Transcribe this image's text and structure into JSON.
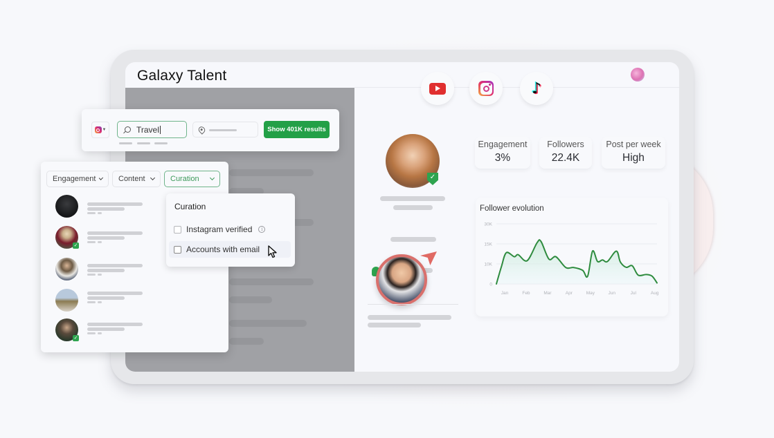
{
  "app": {
    "title": "Galaxy Talent"
  },
  "social_platforms": [
    {
      "name": "YouTube",
      "icon": "youtube-icon"
    },
    {
      "name": "Instagram",
      "icon": "instagram-icon"
    },
    {
      "name": "TikTok",
      "icon": "tiktok-icon",
      "glyph": "♪"
    }
  ],
  "search": {
    "platform": "Instagram",
    "query": "Travel",
    "location_placeholder": "",
    "results_button": "Show 401K results"
  },
  "filters": {
    "buttons": [
      {
        "label": "Engagement",
        "active": false
      },
      {
        "label": "Content",
        "active": false
      },
      {
        "label": "Curation",
        "active": true
      }
    ]
  },
  "creator_list": [
    {
      "verified": false
    },
    {
      "verified": true
    },
    {
      "verified": false
    },
    {
      "verified": false
    },
    {
      "verified": true
    }
  ],
  "curation_dropdown": {
    "title": "Curation",
    "options": [
      {
        "label": "Instagram verified",
        "checked": false,
        "info_icon": true
      },
      {
        "label": "Accounts with email",
        "checked": false,
        "hovered": true
      }
    ]
  },
  "profile": {
    "verified": true,
    "check_glyph": "✓",
    "stats": [
      {
        "label": "Engagement",
        "value": "3%"
      },
      {
        "label": "Followers",
        "value": "22.4K"
      },
      {
        "label": "Post per week",
        "value": "High"
      }
    ]
  },
  "colors": {
    "accent_green": "#23a047",
    "chart_line": "#2e8b3e",
    "verified_green": "#2ea44f",
    "youtube_red": "#e02f2f",
    "contact_ring": "#d9706c"
  },
  "chart_data": {
    "type": "area",
    "title": "Follower evolution",
    "x_ticks": [
      "Jan",
      "Feb",
      "Mar",
      "Apr",
      "May",
      "Jun",
      "Jul",
      "Aug"
    ],
    "y_ticks": [
      "0",
      "10K",
      "15K",
      "30K"
    ],
    "y_tick_values": [
      0,
      10000,
      15000,
      30000
    ],
    "series": [
      {
        "name": "Followers",
        "points": [
          [
            0.0,
            0
          ],
          [
            0.25,
            8500
          ],
          [
            0.5,
            12800
          ],
          [
            0.9,
            11800
          ],
          [
            1.1,
            12300
          ],
          [
            1.55,
            10800
          ],
          [
            2.05,
            15800
          ],
          [
            2.25,
            16800
          ],
          [
            2.65,
            11200
          ],
          [
            3.0,
            11800
          ],
          [
            3.5,
            8200
          ],
          [
            3.9,
            8200
          ],
          [
            4.35,
            6800
          ],
          [
            4.6,
            3800
          ],
          [
            4.85,
            13200
          ],
          [
            5.1,
            10600
          ],
          [
            5.35,
            11000
          ],
          [
            5.6,
            10600
          ],
          [
            6.05,
            13200
          ],
          [
            6.25,
            10500
          ],
          [
            6.55,
            8300
          ],
          [
            6.85,
            9100
          ],
          [
            7.15,
            4400
          ],
          [
            7.55,
            4700
          ],
          [
            7.85,
            3900
          ],
          [
            8.1,
            500
          ]
        ]
      }
    ],
    "xlabel": "",
    "ylabel": "",
    "grid": true
  }
}
